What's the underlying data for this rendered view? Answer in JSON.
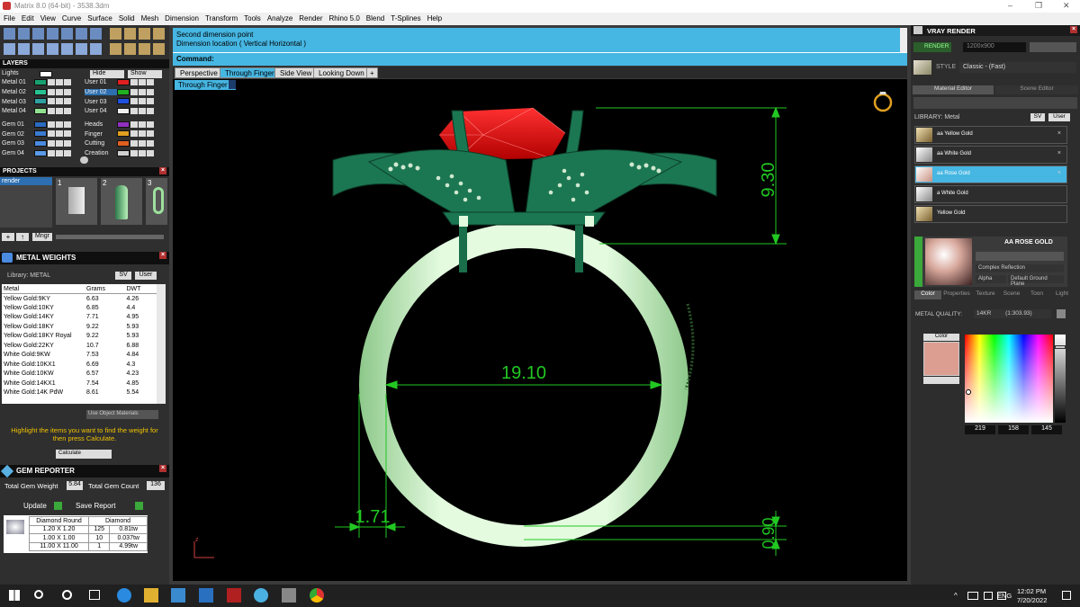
{
  "window": {
    "title": "Matrix 8.0 (64-bit) - 3538.3dm",
    "min": "–",
    "max": "❐",
    "close": "✕"
  },
  "menu": [
    "File",
    "Edit",
    "View",
    "Curve",
    "Surface",
    "Solid",
    "Mesh",
    "Dimension",
    "Transform",
    "Tools",
    "Analyze",
    "Render",
    "Rhino 5.0",
    "Blend",
    "T-Splines",
    "Help"
  ],
  "layers": {
    "title": "LAYERS",
    "lights": "Lights",
    "hide": "Hide",
    "show": "Show",
    "left": [
      {
        "name": "Metal 01",
        "color": "#18a070"
      },
      {
        "name": "Metal 02",
        "color": "#28c090"
      },
      {
        "name": "Metal 03",
        "color": "#30a0a0"
      },
      {
        "name": "Metal 04",
        "color": "#90e090"
      },
      {
        "name": "Gem 01",
        "color": "#2a6ac0"
      },
      {
        "name": "Gem 02",
        "color": "#3a7ad0"
      },
      {
        "name": "Gem 03",
        "color": "#4a8ae0"
      },
      {
        "name": "Gem 04",
        "color": "#5a9ae8"
      }
    ],
    "right": [
      {
        "name": "User 01",
        "color": "#e02020"
      },
      {
        "name": "User 02",
        "color": "#20b020"
      },
      {
        "name": "User 03",
        "color": "#2050e0"
      },
      {
        "name": "User 04",
        "color": "#f0f0f0"
      },
      {
        "name": "Heads",
        "color": "#9030c0"
      },
      {
        "name": "Finger",
        "color": "#e0a020"
      },
      {
        "name": "Cutting",
        "color": "#e06020"
      },
      {
        "name": "Creation",
        "color": "#d0d0d0"
      }
    ]
  },
  "projects": {
    "title": "PROJECTS",
    "item": "render",
    "nums": [
      "1",
      "2",
      "3"
    ],
    "mngr": "Mngr"
  },
  "metal_weights": {
    "title": "METAL WEIGHTS",
    "library": "Library: METAL",
    "sv": "SV",
    "user": "User",
    "headers": [
      "Metal",
      "Grams",
      "DWT"
    ],
    "rows": [
      [
        "Yellow Gold:9KY",
        "6.63",
        "4.26"
      ],
      [
        "Yellow Gold:10KY",
        "6.85",
        "4.4"
      ],
      [
        "Yellow Gold:14KY",
        "7.71",
        "4.95"
      ],
      [
        "Yellow Gold:18KY",
        "9.22",
        "5.93"
      ],
      [
        "Yellow Gold:18KY Royal",
        "9.22",
        "5.93"
      ],
      [
        "Yellow Gold:22KY",
        "10.7",
        "6.88"
      ],
      [
        "White Gold:9KW",
        "7.53",
        "4.84"
      ],
      [
        "White Gold:10KX1",
        "6.69",
        "4.3"
      ],
      [
        "White Gold:10KW",
        "6.57",
        "4.23"
      ],
      [
        "White Gold:14KX1",
        "7.54",
        "4.85"
      ],
      [
        "White Gold:14K PdW",
        "8.61",
        "5.54"
      ]
    ],
    "use_obj": "Use Object Materials",
    "hint": "Highlight the items you want to find the weight for then press Calculate.",
    "calculate": "Calculate"
  },
  "gem_reporter": {
    "title": "GEM REPORTER",
    "total_weight_label": "Total Gem Weight",
    "total_weight": "5.84",
    "total_count_label": "Total Gem Count",
    "total_count": "136",
    "update": "Update",
    "save": "Save Report",
    "headers": [
      "Diamond Round",
      "Diamond"
    ],
    "rows": [
      [
        "1.20 X 1.20",
        "125",
        "0.81tw"
      ],
      [
        "1.00 X 1.00",
        "10",
        "0.037tw"
      ],
      [
        "11.00 X 11.00",
        "1",
        "4.99tw"
      ]
    ]
  },
  "command": {
    "line1": "Second dimension point",
    "line2": "Dimension location ( Vertical  Horizontal )",
    "prompt": "Command:"
  },
  "tabs": [
    "Perspective",
    "Through Finger",
    "Side View",
    "Looking Down",
    "+"
  ],
  "viewport": {
    "label": "Through Finger",
    "dims": [
      "9.30",
      "19.10",
      "1.71",
      "0.90"
    ],
    "axis": "z"
  },
  "vray": {
    "title": "VRAY RENDER",
    "render": "RENDER",
    "res": "1200x900",
    "style_label": "STYLE",
    "style": "Classic - (Fast)",
    "material_editor": "Material Editor",
    "scene_editor": "Scene Editor",
    "library": "LIBRARY: Metal",
    "sv": "SV",
    "user": "User",
    "materials": [
      "aa Yellow Gold",
      "aa White Gold",
      "aa Rose Gold",
      "a White Gold",
      "Yellow Gold"
    ],
    "selected": "AA ROSE GOLD",
    "complex": "Complex Reflection",
    "alpha": "Alpha",
    "ground": "Default Ground Plane",
    "subtabs": [
      "Color",
      "Properties",
      "Texture",
      "Scene",
      "Toon",
      "Light"
    ],
    "metal_quality_label": "METAL QUALITY:",
    "metal_quality": "14KR",
    "metal_quality_val": "(1:303.93)",
    "color_label": "Color",
    "rgb": [
      "219",
      "158",
      "145"
    ]
  },
  "taskbar": {
    "lang": "ENG",
    "time": "12:02 PM",
    "date": "7/20/2022"
  },
  "colors": {
    "accent": "#46b6e2",
    "ring": "#d8f5d0",
    "gem": "#e01010",
    "prongs": "#1a6e4a",
    "dim": "#22c822"
  }
}
